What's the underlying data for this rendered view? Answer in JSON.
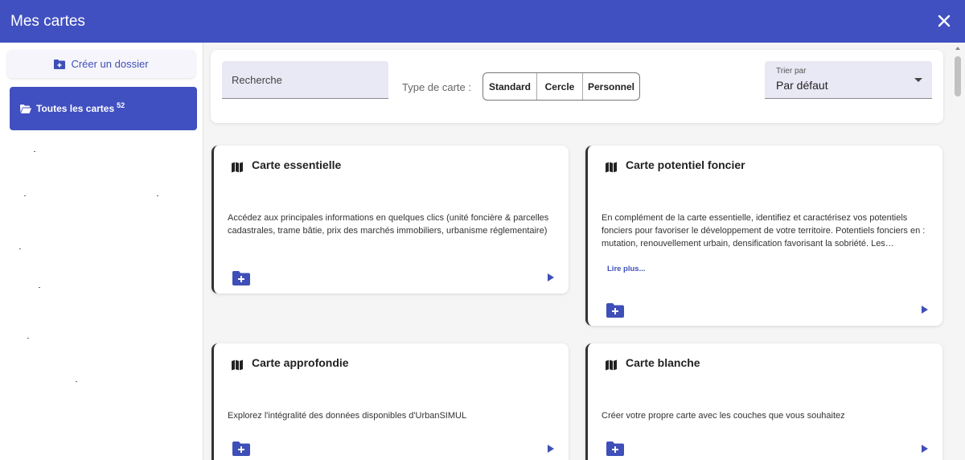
{
  "header": {
    "title": "Mes cartes"
  },
  "sidebar": {
    "create_label": "Créer un dossier",
    "all_cards_label": "Toutes les cartes",
    "all_cards_count": "52"
  },
  "filters": {
    "search_placeholder": "Recherche",
    "type_label": "Type de carte :",
    "types": [
      "Standard",
      "Cercle",
      "Personnel"
    ],
    "sort_label": "Trier par",
    "sort_value": "Par défaut"
  },
  "cards": [
    {
      "title": "Carte essentielle",
      "description": "Accédez aux principales informations en quelques clics (unité foncière & parcelles cadastrales, trame bâtie, prix des marchés immobiliers, urbanisme réglementaire)"
    },
    {
      "title": "Carte potentiel foncier",
      "description": "En complément de la carte essentielle, identifiez et caractérisez vos potentiels fonciers pour favoriser le développement de votre territoire. Potentiels fonciers en : mutation, renouvellement urbain, densification favorisant la sobriété. Les…",
      "more": "Lire plus..."
    },
    {
      "title": "Carte approfondie",
      "description": "Explorez l'intégralité des données disponibles d'UrbanSIMUL"
    },
    {
      "title": "Carte blanche",
      "description": "Créer votre propre carte avec les couches que vous souhaitez"
    }
  ],
  "colors": {
    "primary": "#4150c0",
    "input_bg": "#e9e8f5"
  }
}
